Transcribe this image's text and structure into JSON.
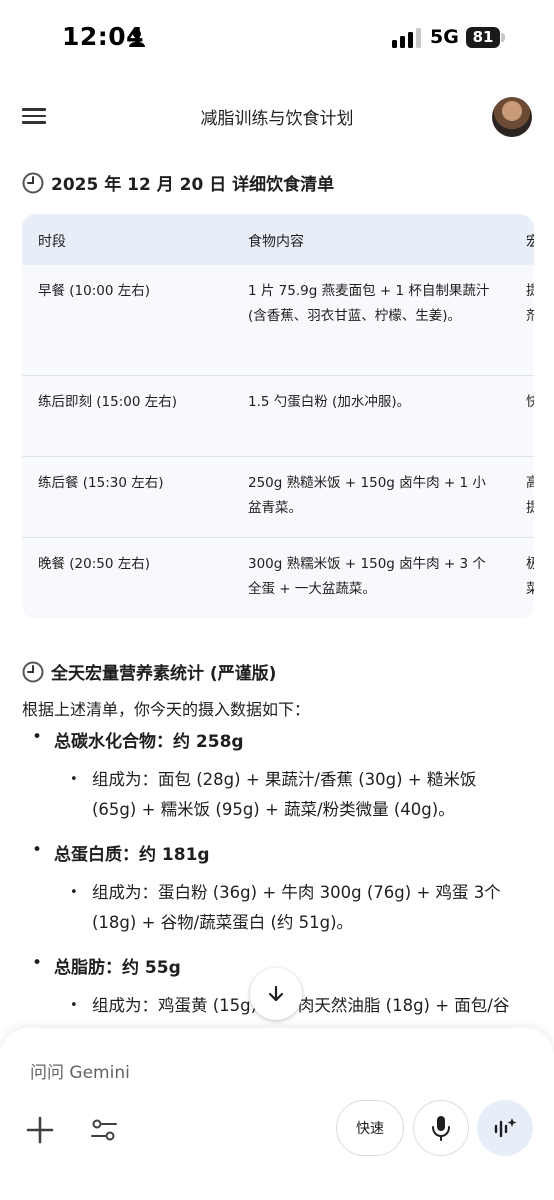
{
  "status_bar": {
    "time": "12:04",
    "network": "5G",
    "battery": "81"
  },
  "header": {
    "title": "减脂训练与饮食计划"
  },
  "section1": {
    "title": "2025 年 12 月 20 日 详细饮食清单",
    "table": {
      "headers": [
        "时段",
        "食物内容",
        "宏"
      ],
      "rows": [
        {
          "period": "早餐 (10:00 左右)",
          "food_lines": [
            "1 片 75.9g 燕麦面包 + 1 杯自制果蔬汁",
            "(含香蕉、羽衣甘蓝、柠檬、生姜)。"
          ],
          "macro_lines": [
            "提",
            "剂"
          ]
        },
        {
          "period": "练后即刻 (15:00 左右)",
          "food_lines": [
            "1.5 勺蛋白粉 (加水冲服)。"
          ],
          "macro_lines": [
            "快"
          ]
        },
        {
          "period": "练后餐 (15:30 左右)",
          "food_lines": [
            "250g 熟糙米饭 + 150g 卤牛肉 + 1 小",
            "盆青菜。"
          ],
          "macro_lines": [
            "高",
            "提"
          ]
        },
        {
          "period": "晚餐 (20:50 左右)",
          "food_lines": [
            "300g 熟糯米饭 + 150g 卤牛肉 + 3 个",
            "全蛋 + 一大盆蔬菜。"
          ],
          "macro_lines": [
            "极",
            "菜"
          ]
        }
      ]
    }
  },
  "section2": {
    "title": "全天宏量营养素统计 (严谨版)",
    "intro": "根据上述清单，你今天的摄入数据如下：",
    "items": [
      {
        "label": "总碳水化合物：约 258g",
        "detail_lines": [
          "组成为：面包 (28g) + 果蔬汁/香蕉 (30g) + 糙米饭",
          "(65g) + 糯米饭 (95g) + 蔬菜/粉类微量 (40g)。"
        ]
      },
      {
        "label": "总蛋白质：约 181g",
        "detail_lines": [
          "组成为：蛋白粉 (36g) + 牛肉 300g (76g) + 鸡蛋 3个",
          "(18g) + 谷物/蔬菜蛋白 (约 51g)。"
        ]
      },
      {
        "label": "总脂肪：约 55g",
        "detail_lines": [
          "组成为：鸡蛋黄 (15g) + 牛肉天然油脂 (18g) + 面包/谷"
        ]
      }
    ]
  },
  "composer": {
    "placeholder": "问问 Gemini",
    "fast_label": "快速"
  },
  "colors": {
    "table_header_bg": "#e8eef7",
    "table_body_bg": "#f7f9fc",
    "live_button_bg": "#e8eef7"
  },
  "icons": [
    "person-icon",
    "signal-icon",
    "menu-icon",
    "clock-icon",
    "arrow-down-icon",
    "plus-icon",
    "tools-icon",
    "mic-icon",
    "live-icon"
  ]
}
